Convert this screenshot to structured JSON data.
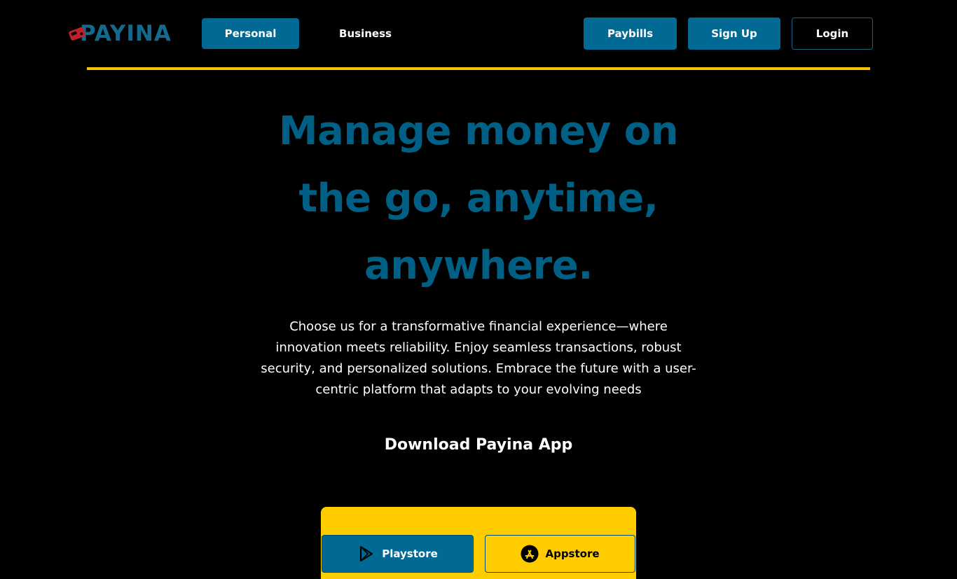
{
  "brand": {
    "name": "PAYINA",
    "colors": {
      "primary": "#006a95",
      "accent": "#ffcc00",
      "logo_red": "#c0202a",
      "background": "#000000"
    }
  },
  "nav": {
    "personal_label": "Personal",
    "business_label": "Business"
  },
  "header_actions": {
    "paybills_label": "Paybills",
    "signup_label": "Sign Up",
    "login_label": "Login"
  },
  "hero": {
    "title_line1": "Manage money on",
    "title_line2": "the go, anytime,",
    "title_line3": "anywhere.",
    "description_line1": "Choose us for a transformative financial experience—where",
    "description_line2": "innovation meets reliability. Enjoy seamless transactions, robust",
    "description_line3": "security, and personalized solutions. Embrace the future with a user-",
    "description_line4": "centric platform that adapts to your evolving needs"
  },
  "download": {
    "heading": "Download Payina App",
    "playstore_label": "Playstore",
    "appstore_label": "Appstore",
    "playstore_icon": "play-store-icon",
    "appstore_icon": "app-store-icon"
  }
}
